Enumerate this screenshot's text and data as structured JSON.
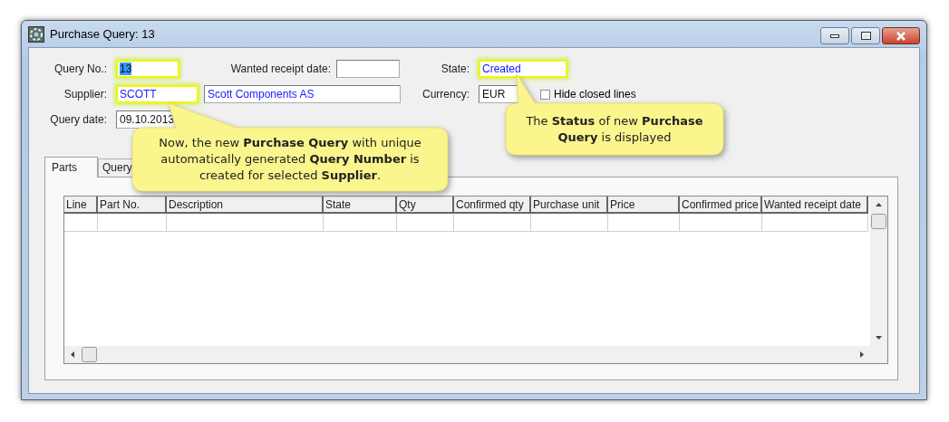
{
  "window": {
    "title": "Purchase Query: 13"
  },
  "form": {
    "query_no": {
      "label": "Query No.:",
      "value": "13",
      "kind": "text",
      "highlighted": true,
      "text_selected": true
    },
    "wanted_receipt_date": {
      "label": "Wanted receipt date:",
      "highlighted": false
    },
    "state": {
      "label": "State:",
      "value": "Created",
      "kind": "reference",
      "highlighted": true
    },
    "supplier": {
      "label": "Supplier:",
      "value": "SCOTT",
      "kind": "reference",
      "highlighted": true
    },
    "supplier_name": {
      "value": "Scott Components AS",
      "kind": "reference",
      "highlighted": false
    },
    "currency": {
      "label": "Currency:",
      "value": "EUR",
      "kind": "text",
      "highlighted": false
    },
    "hide_closed_lines": {
      "label": "Hide closed lines",
      "checked": false
    },
    "query_date": {
      "label": "Query date:",
      "value": "09.10.2013",
      "kind": "text",
      "highlighted": false
    }
  },
  "tabs": [
    {
      "label": "Parts",
      "selected": true
    },
    {
      "label": "Query",
      "selected": false
    }
  ],
  "table": {
    "columns": [
      "Line",
      "Part No.",
      "Description",
      "State",
      "Qty",
      "Confirmed qty",
      "Purchase unit",
      "Price",
      "Confirmed price",
      "Wanted receipt date"
    ]
  },
  "callouts": [
    {
      "text": "Now, the new **Purchase Query** with unique automatically generated **Query Number** is created for selected **Supplier**."
    },
    {
      "text": "The **Status** of new **Purchase Query** is displayed"
    }
  ]
}
